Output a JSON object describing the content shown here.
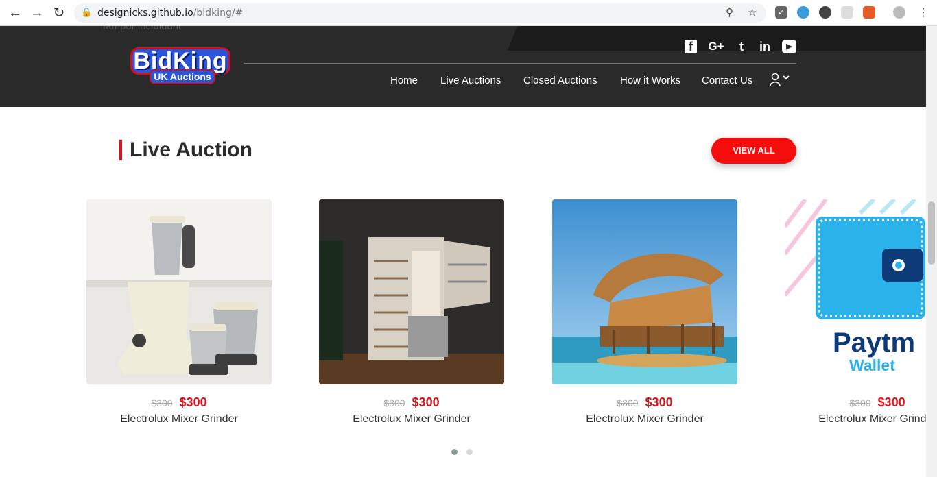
{
  "browser": {
    "url_domain": "designicks.github.io",
    "url_path": "/bidking/#"
  },
  "header": {
    "ghost_text": "tampor incididunt",
    "logo_line1": "BidKing",
    "logo_line2": "UK Auctions",
    "social": [
      "facebook-icon",
      "google-plus-icon",
      "twitter-icon",
      "linkedin-icon",
      "youtube-icon"
    ],
    "social_glyphs": {
      "facebook": "f",
      "google": "G+",
      "twitter": "t",
      "linkedin": "in",
      "youtube": "▶"
    },
    "menu": [
      "Home",
      "Live Auctions",
      "Closed Auctions",
      "How it Works",
      "Contact Us"
    ]
  },
  "section": {
    "title": "Live Auction",
    "view_all": "VIEW ALL"
  },
  "cards": [
    {
      "old_price": "$300",
      "price": "$300",
      "title": "Electrolux Mixer Grinder"
    },
    {
      "old_price": "$300",
      "price": "$300",
      "title": "Electrolux Mixer Grinder"
    },
    {
      "old_price": "$300",
      "price": "$300",
      "title": "Electrolux Mixer Grinder"
    },
    {
      "old_price": "$300",
      "price": "$300",
      "title": "Electrolux Mixer Grinder"
    }
  ],
  "paytm": {
    "brand": "Paytm",
    "sub": "Wallet"
  },
  "carousel": {
    "pages": 2,
    "active": 1
  },
  "colors": {
    "accent": "#e0121b",
    "header_bg": "#2a2a2a",
    "button": "#f50c0c"
  }
}
